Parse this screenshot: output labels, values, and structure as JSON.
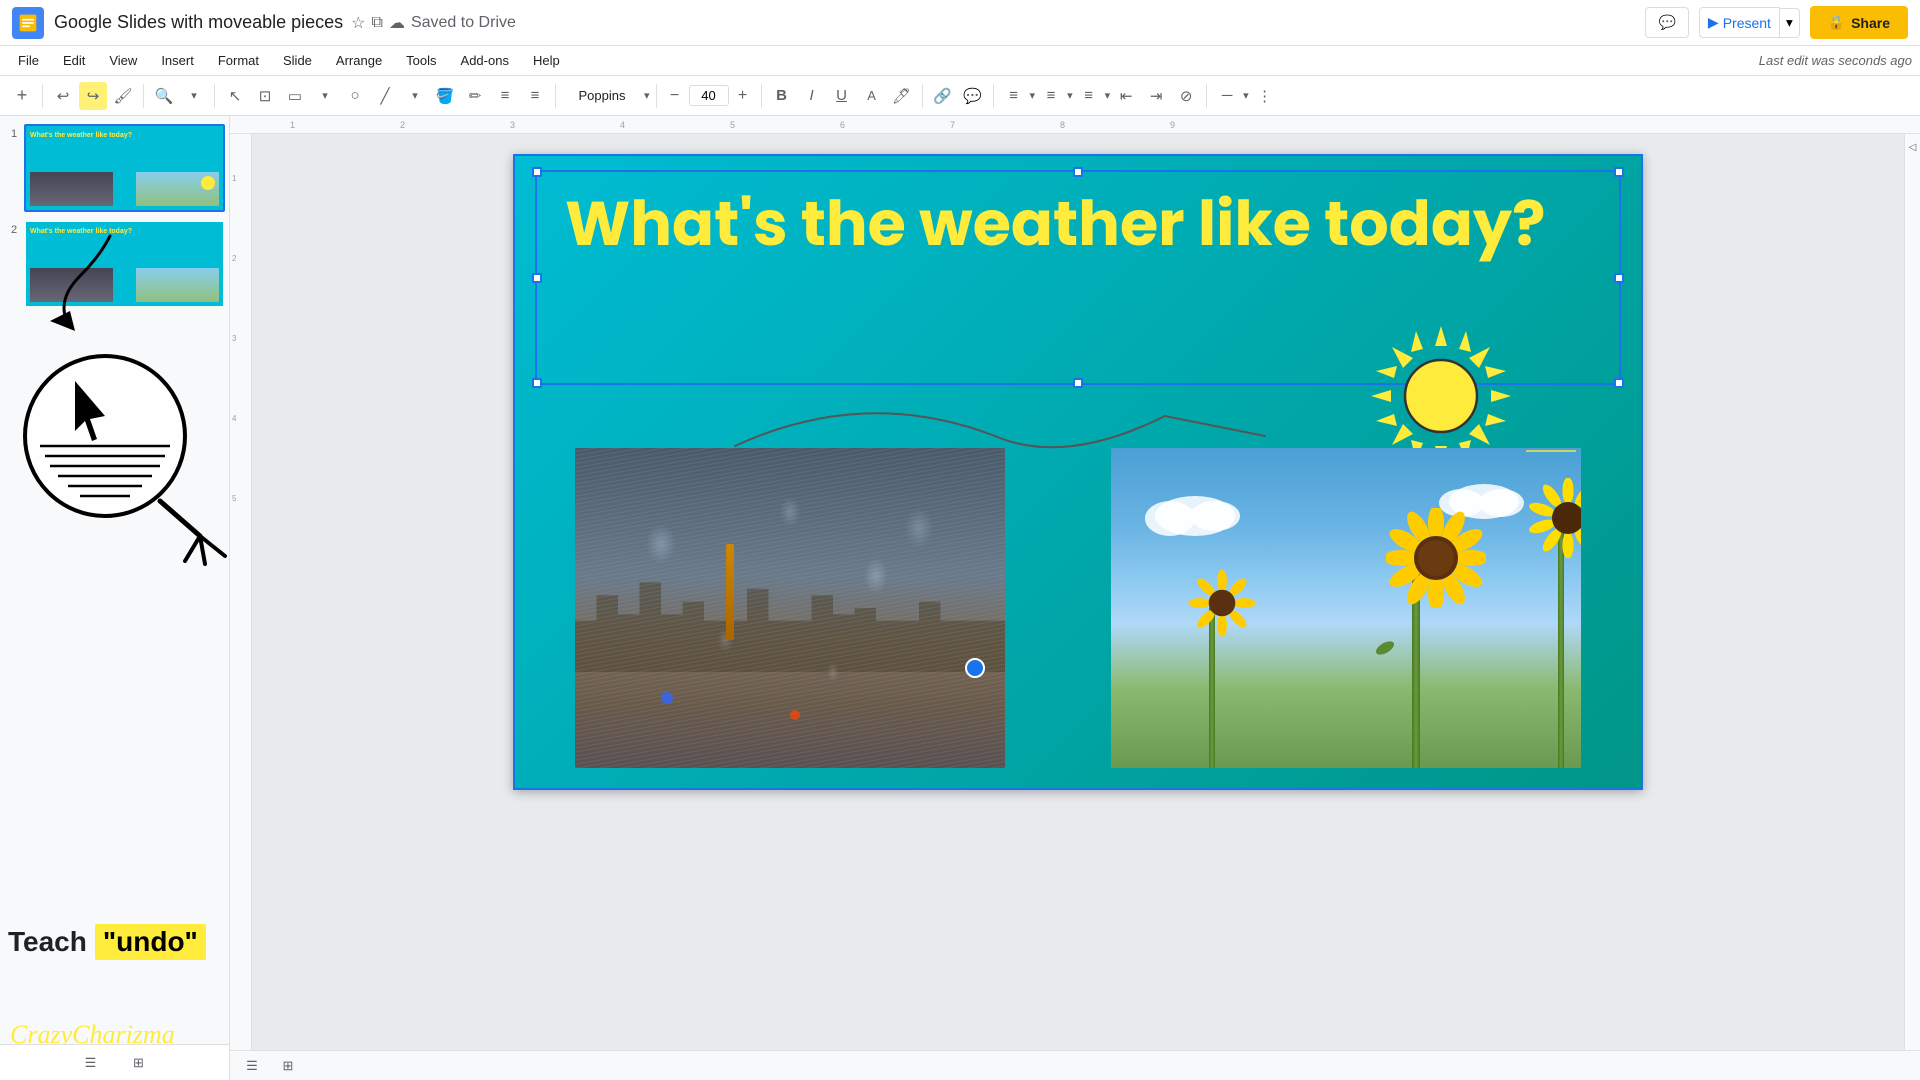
{
  "app": {
    "logo_color": "#fbbc04",
    "title": "Google Slides with moveable pieces",
    "star_icon": "★",
    "present_icon": "▶",
    "saved_text": "Saved to Drive",
    "last_edit": "Last edit was seconds ago"
  },
  "header": {
    "share_label": "Share",
    "present_label": "Present",
    "comments_icon": "💬"
  },
  "menu": {
    "items": [
      "File",
      "Edit",
      "View",
      "Insert",
      "Format",
      "Slide",
      "Arrange",
      "Tools",
      "Add-ons",
      "Help"
    ]
  },
  "toolbar": {
    "undo": "↩",
    "redo": "↪",
    "zoom_icon": "🔍",
    "font_family": "Poppins",
    "font_size": "40",
    "bold": "B",
    "italic": "I",
    "underline": "U"
  },
  "slide": {
    "title": "What's the weather like today?",
    "background_color": "#00bcd4"
  },
  "sidebar": {
    "slides": [
      {
        "num": "1",
        "active": true
      },
      {
        "num": "2",
        "active": false
      }
    ],
    "teach_text": "Teach",
    "undo_label": "\"undo\"",
    "brand_text": "CrazyCharizma"
  },
  "ruler": {
    "marks": [
      "1",
      "2",
      "3",
      "4",
      "5",
      "6",
      "7",
      "8",
      "9"
    ]
  },
  "bottom": {
    "view_list": "☰",
    "view_grid": "⊞"
  }
}
